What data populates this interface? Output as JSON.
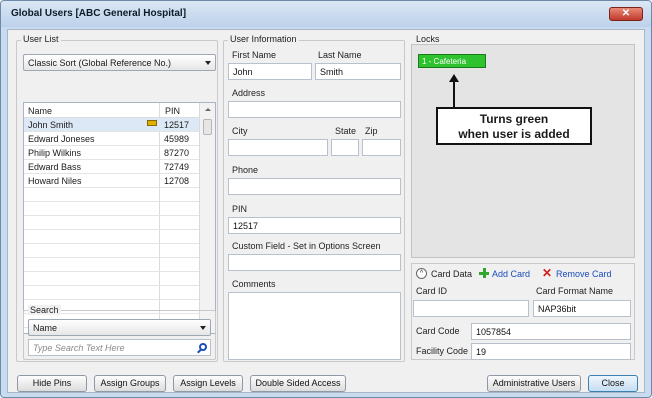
{
  "window": {
    "title": "Global Users [ABC General Hospital]",
    "close_glyph": "✕"
  },
  "user_list": {
    "group_label": "User List",
    "sort_value": "Classic Sort (Global Reference No.)",
    "columns": [
      "Name",
      "PIN"
    ],
    "rows": [
      {
        "name": "John Smith",
        "pin": "12517"
      },
      {
        "name": "Edward Joneses",
        "pin": "45989"
      },
      {
        "name": "Philip Wilkins",
        "pin": "87270"
      },
      {
        "name": "Edward Bass",
        "pin": "72749"
      },
      {
        "name": "Howard Niles",
        "pin": "12708"
      }
    ]
  },
  "search": {
    "group_label": "Search",
    "field_value": "Name",
    "placeholder": "Type Search Text Here"
  },
  "user_info": {
    "group_label": "User Information",
    "first_name_label": "First Name",
    "last_name_label": "Last Name",
    "first_name": "John",
    "last_name": "Smith",
    "address_label": "Address",
    "city_label": "City",
    "state_label": "State",
    "zip_label": "Zip",
    "phone_label": "Phone",
    "pin_label": "PIN",
    "pin": "12517",
    "custom_label": "Custom Field - Set in Options Screen",
    "comments_label": "Comments"
  },
  "locks": {
    "group_label": "Locks",
    "items": [
      "1 - Cafeteria"
    ],
    "annotation_line1": "Turns green",
    "annotation_line2": "when user is added",
    "active_color": "#2fc22f"
  },
  "card_data": {
    "header_label": "Card Data",
    "add_label": "Add Card",
    "remove_label": "Remove Card",
    "card_id_label": "Card ID",
    "card_format_label": "Card Format Name",
    "card_format": "NAP36bit",
    "card_code_label": "Card Code",
    "card_code": "1057854",
    "facility_code_label": "Facility Code",
    "facility_code": "19"
  },
  "buttons": {
    "hide_pins": "Hide Pins",
    "assign_groups": "Assign Groups",
    "assign_levels": "Assign Levels",
    "double_sided": "Double Sided Access",
    "admin_users": "Administrative Users",
    "close": "Close"
  }
}
